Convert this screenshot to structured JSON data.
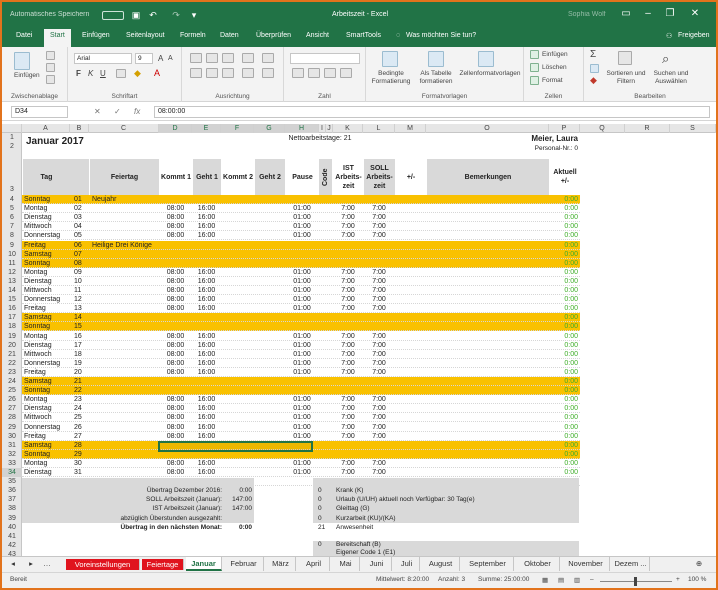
{
  "title": {
    "autosave": "Automatisches Speichern",
    "doc": "Arbeitszeit - Excel",
    "user": "Sophia Wolf"
  },
  "tabs": [
    "Datei",
    "Start",
    "Einfügen",
    "Seitenlayout",
    "Formeln",
    "Daten",
    "Überprüfen",
    "Ansicht",
    "SmartTools"
  ],
  "tell_me": "Was möchten Sie tun?",
  "share": "Freigeben",
  "ribbon": {
    "paste": "Einfügen",
    "clipboard": "Zwischenablage",
    "font_name": "Arial",
    "font_size": "9",
    "font": "Schriftart",
    "alignment": "Ausrichtung",
    "number": "Zahl",
    "cond_format": "Bedingte Formatierung",
    "as_table": "Als Tabelle formatieren",
    "cell_styles": "Zellenformatvorlagen",
    "styles": "Formatvorlagen",
    "insert": "Einfügen",
    "delete": "Löschen",
    "format": "Format",
    "cells": "Zellen",
    "sort": "Sortieren und Filtern",
    "find": "Suchen und Auswählen",
    "editing": "Bearbeiten"
  },
  "formula_bar": {
    "name_box": "D34",
    "value": "08:00:00"
  },
  "columns": [
    "A",
    "B",
    "C",
    "D",
    "E",
    "F",
    "G",
    "H",
    "I",
    "J",
    "K",
    "L",
    "M",
    "O",
    "P",
    "Q",
    "R",
    "S"
  ],
  "rows": [
    "1",
    "2",
    "3",
    "4",
    "5",
    "6",
    "7",
    "8",
    "9",
    "10",
    "11",
    "12",
    "13",
    "14",
    "15",
    "16",
    "17",
    "18",
    "19",
    "20",
    "21",
    "22",
    "23",
    "24",
    "25",
    "26",
    "27",
    "28",
    "29",
    "30",
    "31",
    "32",
    "33",
    "34",
    "35",
    "36",
    "37",
    "38",
    "39",
    "40",
    "41",
    "42",
    "43"
  ],
  "sheet": {
    "title": "Januar 2017",
    "nettoarbeitstage": "Nettoarbeitstage: 21",
    "person": "Meier, Laura",
    "personal_nr": "Personal-Nr.: 0",
    "headers": {
      "tag": "Tag",
      "feiertag": "Feiertag",
      "kommt1": "Kommt 1",
      "geht1": "Geht 1",
      "kommt2": "Kommt 2",
      "geht2": "Geht 2",
      "pause": "Pause",
      "code": "Code",
      "ist": "IST Arbeits-zeit",
      "soll": "SOLL Arbeits-zeit",
      "diff": "+/-",
      "bemerkungen": "Bemerkungen",
      "aktuell": "Aktuell +/-"
    },
    "days": [
      {
        "d": "Sonntag",
        "n": "01",
        "f": "Neujahr",
        "we": true
      },
      {
        "d": "Montag",
        "n": "02",
        "f": "",
        "we": false
      },
      {
        "d": "Dienstag",
        "n": "03",
        "f": "",
        "we": false
      },
      {
        "d": "Mittwoch",
        "n": "04",
        "f": "",
        "we": false
      },
      {
        "d": "Donnerstag",
        "n": "05",
        "f": "",
        "we": false
      },
      {
        "d": "Freitag",
        "n": "06",
        "f": "Heilige Drei Könige",
        "we": true
      },
      {
        "d": "Samstag",
        "n": "07",
        "f": "",
        "we": true
      },
      {
        "d": "Sonntag",
        "n": "08",
        "f": "",
        "we": true
      },
      {
        "d": "Montag",
        "n": "09",
        "f": "",
        "we": false
      },
      {
        "d": "Dienstag",
        "n": "10",
        "f": "",
        "we": false
      },
      {
        "d": "Mittwoch",
        "n": "11",
        "f": "",
        "we": false
      },
      {
        "d": "Donnerstag",
        "n": "12",
        "f": "",
        "we": false
      },
      {
        "d": "Freitag",
        "n": "13",
        "f": "",
        "we": false
      },
      {
        "d": "Samstag",
        "n": "14",
        "f": "",
        "we": true
      },
      {
        "d": "Sonntag",
        "n": "15",
        "f": "",
        "we": true
      },
      {
        "d": "Montag",
        "n": "16",
        "f": "",
        "we": false
      },
      {
        "d": "Dienstag",
        "n": "17",
        "f": "",
        "we": false
      },
      {
        "d": "Mittwoch",
        "n": "18",
        "f": "",
        "we": false
      },
      {
        "d": "Donnerstag",
        "n": "19",
        "f": "",
        "we": false
      },
      {
        "d": "Freitag",
        "n": "20",
        "f": "",
        "we": false
      },
      {
        "d": "Samstag",
        "n": "21",
        "f": "",
        "we": true
      },
      {
        "d": "Sonntag",
        "n": "22",
        "f": "",
        "we": true
      },
      {
        "d": "Montag",
        "n": "23",
        "f": "",
        "we": false
      },
      {
        "d": "Dienstag",
        "n": "24",
        "f": "",
        "we": false
      },
      {
        "d": "Mittwoch",
        "n": "25",
        "f": "",
        "we": false
      },
      {
        "d": "Donnerstag",
        "n": "26",
        "f": "",
        "we": false
      },
      {
        "d": "Freitag",
        "n": "27",
        "f": "",
        "we": false
      },
      {
        "d": "Samstag",
        "n": "28",
        "f": "",
        "we": true
      },
      {
        "d": "Sonntag",
        "n": "29",
        "f": "",
        "we": true
      },
      {
        "d": "Montag",
        "n": "30",
        "f": "",
        "we": false
      },
      {
        "d": "Dienstag",
        "n": "31",
        "f": "",
        "we": false
      }
    ],
    "work": {
      "kommt": "08:00",
      "geht": "16:00",
      "pause": "01:00",
      "ist": "7:00",
      "soll": "7:00"
    },
    "aktuell": "0:00",
    "summary_left": [
      {
        "label": "Übertrag Dezember 2016:",
        "value": "0:00"
      },
      {
        "label": "SOLL Arbeitszeit (Januar):",
        "value": "147:00"
      },
      {
        "label": "IST Arbeitszeit (Januar):",
        "value": "147:00"
      },
      {
        "label": "abzüglich Überstunden ausgezahlt:",
        "value": ""
      },
      {
        "label": "Übertrag in den nächsten Monat:",
        "value": "0:00"
      }
    ],
    "summary_right": [
      {
        "n": "0",
        "label": "Krank (K)"
      },
      {
        "n": "0",
        "label": "Urlaub (U/UH) aktuell noch Verfügbar: 30 Tag(e)"
      },
      {
        "n": "0",
        "label": "Gleittag (G)"
      },
      {
        "n": "0",
        "label": "Kurzarbeit (KU)/(KA)"
      },
      {
        "n": "21",
        "label": "Anwesenheit"
      }
    ],
    "summary_right2": [
      {
        "n": "0",
        "label": "Bereitschaft (B)"
      },
      {
        "n": "",
        "label": "Eigener Code 1 (E1)"
      }
    ]
  },
  "sheet_tabs": [
    {
      "label": "Voreinstellungen",
      "type": "red"
    },
    {
      "label": "Feiertage",
      "type": "red"
    },
    {
      "label": "Januar",
      "type": "active"
    },
    {
      "label": "Februar",
      "type": ""
    },
    {
      "label": "März",
      "type": ""
    },
    {
      "label": "April",
      "type": ""
    },
    {
      "label": "Mai",
      "type": ""
    },
    {
      "label": "Juni",
      "type": ""
    },
    {
      "label": "Juli",
      "type": ""
    },
    {
      "label": "August",
      "type": ""
    },
    {
      "label": "September",
      "type": ""
    },
    {
      "label": "Oktober",
      "type": ""
    },
    {
      "label": "November",
      "type": ""
    },
    {
      "label": "Dezem ...",
      "type": ""
    }
  ],
  "status": {
    "ready": "Bereit",
    "avg": "Mittelwert: 8:20:00",
    "count": "Anzahl: 3",
    "sum": "Summe: 25:00:00",
    "zoom": "100 %"
  },
  "colors": {
    "accent": "#217346",
    "weekend": "#f9c100",
    "positive": "#3fae29",
    "frame": "#e2731c",
    "tab_red": "#e0141e"
  }
}
